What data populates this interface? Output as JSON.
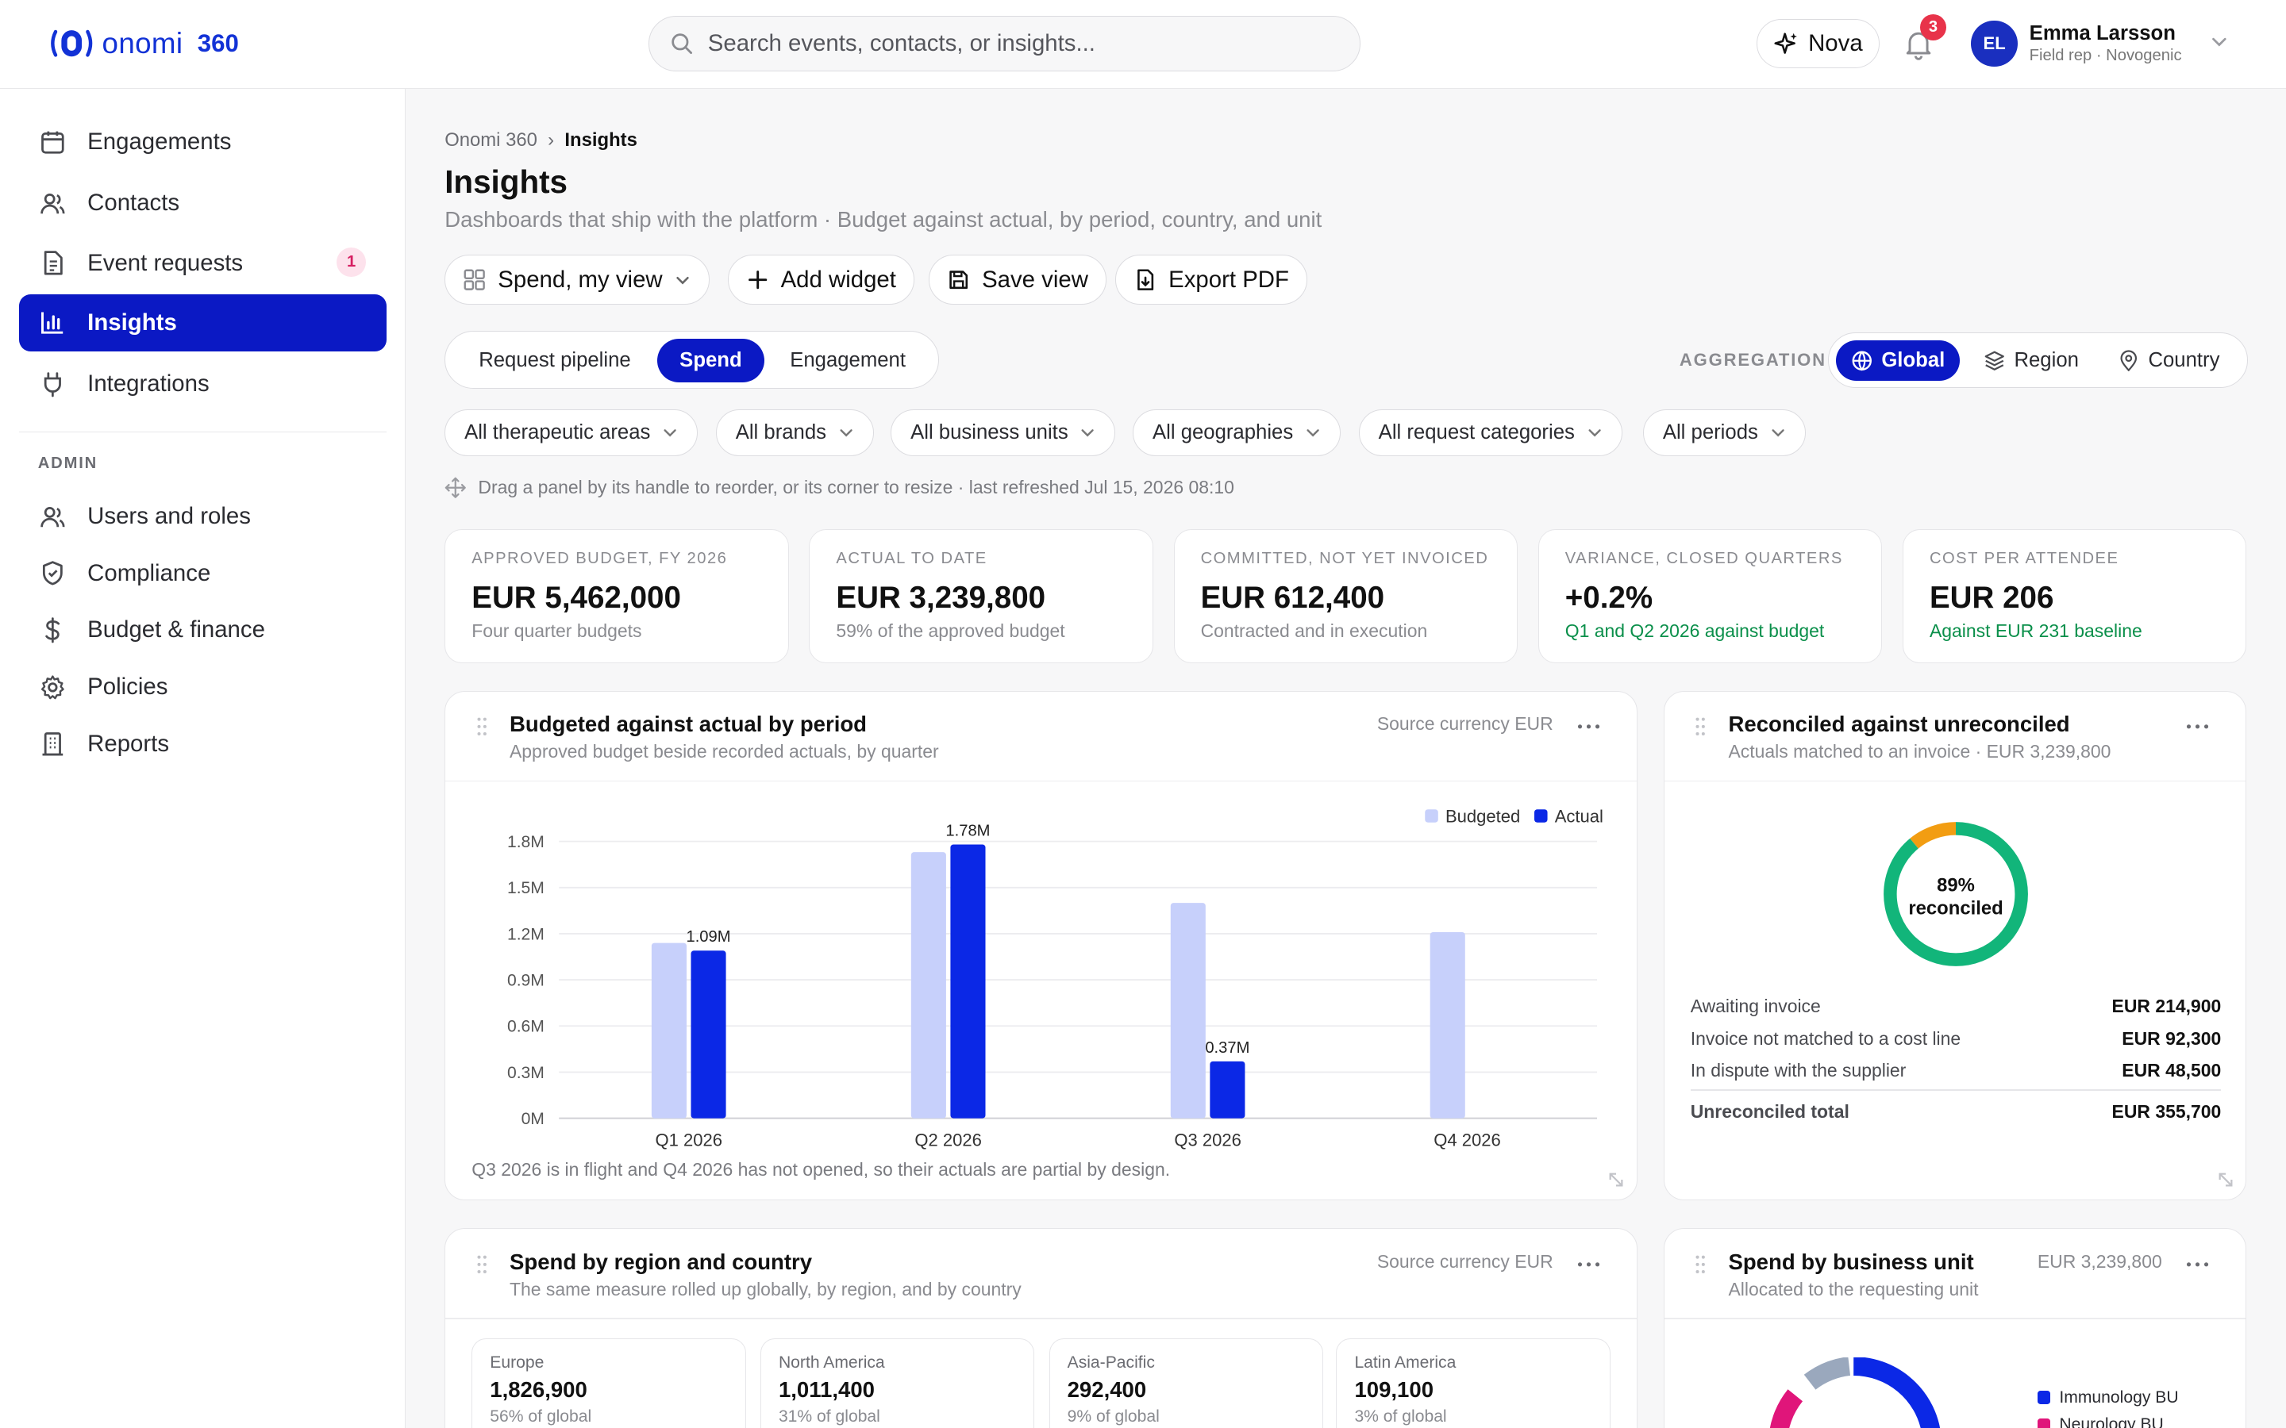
{
  "header": {
    "brand": "onomi",
    "product": "360",
    "search_placeholder": "Search events, contacts, or insights...",
    "assistant_label": "Nova",
    "notification_count": "3",
    "user": {
      "initials": "EL",
      "name": "Emma Larsson",
      "role": "Field rep · Novogenic"
    }
  },
  "sidebar": {
    "items": [
      {
        "label": "Engagements",
        "icon": "calendar-icon"
      },
      {
        "label": "Contacts",
        "icon": "users-icon"
      },
      {
        "label": "Event requests",
        "icon": "document-icon",
        "badge": "1"
      },
      {
        "label": "Insights",
        "icon": "bar-chart-icon",
        "active": true
      },
      {
        "label": "Integrations",
        "icon": "plug-icon"
      }
    ],
    "admin_heading": "ADMIN",
    "admin_items": [
      {
        "label": "Users and roles",
        "icon": "users-icon"
      },
      {
        "label": "Compliance",
        "icon": "shield-icon"
      },
      {
        "label": "Budget & finance",
        "icon": "dollar-icon"
      },
      {
        "label": "Policies",
        "icon": "gear-icon"
      },
      {
        "label": "Reports",
        "icon": "building-icon"
      }
    ]
  },
  "breadcrumb": {
    "root": "Onomi 360",
    "current": "Insights"
  },
  "page": {
    "title": "Insights",
    "subtitle": "Dashboards that ship with the platform · Budget against actual, by period, country, and unit"
  },
  "toolbar": {
    "view_label": "Spend, my view",
    "add_widget": "Add widget",
    "save_view": "Save view",
    "export_pdf": "Export PDF"
  },
  "tabs": [
    "Request pipeline",
    "Spend",
    "Engagement"
  ],
  "active_tab": "Spend",
  "aggregation": {
    "label": "AGGREGATION",
    "options": [
      "Global",
      "Region",
      "Country"
    ],
    "active": "Global"
  },
  "filters": [
    "All therapeutic areas",
    "All brands",
    "All business units",
    "All geographies",
    "All request categories",
    "All periods"
  ],
  "hint": "Drag a panel by its handle to reorder, or its corner to resize · last refreshed Jul 15, 2026 08:10",
  "kpis": [
    {
      "label": "APPROVED BUDGET, FY 2026",
      "value": "EUR 5,462,000",
      "note": "Four quarter budgets"
    },
    {
      "label": "ACTUAL TO DATE",
      "value": "EUR 3,239,800",
      "note": "59% of the approved budget"
    },
    {
      "label": "COMMITTED, NOT YET INVOICED",
      "value": "EUR 612,400",
      "note": "Contracted and in execution"
    },
    {
      "label": "VARIANCE, CLOSED QUARTERS",
      "value": "+0.2%",
      "note": "Q1 and Q2 2026 against budget",
      "positive": true
    },
    {
      "label": "COST PER ATTENDEE",
      "value": "EUR 206",
      "note": "Against EUR 231 baseline",
      "positive": true
    }
  ],
  "budget_panel": {
    "title": "Budgeted against actual by period",
    "subtitle": "Approved budget beside recorded actuals, by quarter",
    "meta": "Source currency EUR",
    "note": "Q3 2026 is in flight and Q4 2026 has not opened, so their actuals are partial by design."
  },
  "chart_data": {
    "type": "bar",
    "categories": [
      "Q1 2026",
      "Q2 2026",
      "Q3 2026",
      "Q4 2026"
    ],
    "series": [
      {
        "name": "Budgeted",
        "values": [
          1.14,
          1.73,
          1.4,
          1.21
        ],
        "color": "#c7d0fb"
      },
      {
        "name": "Actual",
        "values": [
          1.09,
          1.78,
          0.37,
          null
        ],
        "color": "#0b28e6"
      }
    ],
    "data_labels": [
      "1.09M",
      "1.78M",
      "0.37M",
      null
    ],
    "y_ticks": [
      "0M",
      "0.3M",
      "0.6M",
      "0.9M",
      "1.2M",
      "1.5M",
      "1.8M"
    ],
    "ylim": [
      0,
      1.8
    ],
    "grid": true,
    "legend": "top-right"
  },
  "recon_panel": {
    "title": "Reconciled against unreconciled",
    "subtitle": "Actuals matched to an invoice · EUR 3,239,800",
    "center_pct": "89%",
    "center_label": "reconciled",
    "reconciled_fraction": 0.89,
    "colors": {
      "reconciled": "#12b57a",
      "unreconciled": "#f29d12"
    },
    "rows": [
      {
        "label": "Awaiting invoice",
        "value": "EUR 214,900"
      },
      {
        "label": "Invoice not matched to a cost line",
        "value": "EUR 92,300"
      },
      {
        "label": "In dispute with the supplier",
        "value": "EUR 48,500"
      }
    ],
    "total": {
      "label": "Unreconciled total",
      "value": "EUR 355,700"
    }
  },
  "region_panel": {
    "title": "Spend by region and country",
    "subtitle": "The same measure rolled up globally, by region, and by country",
    "meta": "Source currency EUR",
    "regions": [
      {
        "name": "Europe",
        "value": "1,826,900",
        "pct": "56% of global"
      },
      {
        "name": "North America",
        "value": "1,011,400",
        "pct": "31% of global"
      },
      {
        "name": "Asia-Pacific",
        "value": "292,400",
        "pct": "9% of global"
      },
      {
        "name": "Latin America",
        "value": "109,100",
        "pct": "3% of global"
      }
    ]
  },
  "bu_panel": {
    "title": "Spend by business unit",
    "subtitle": "Allocated to the requesting unit",
    "meta": "EUR 3,239,800",
    "legend": [
      {
        "name": "Immunology BU",
        "color": "#0b28e6"
      },
      {
        "name": "Neurology BU",
        "color": "#e0157a"
      }
    ]
  }
}
